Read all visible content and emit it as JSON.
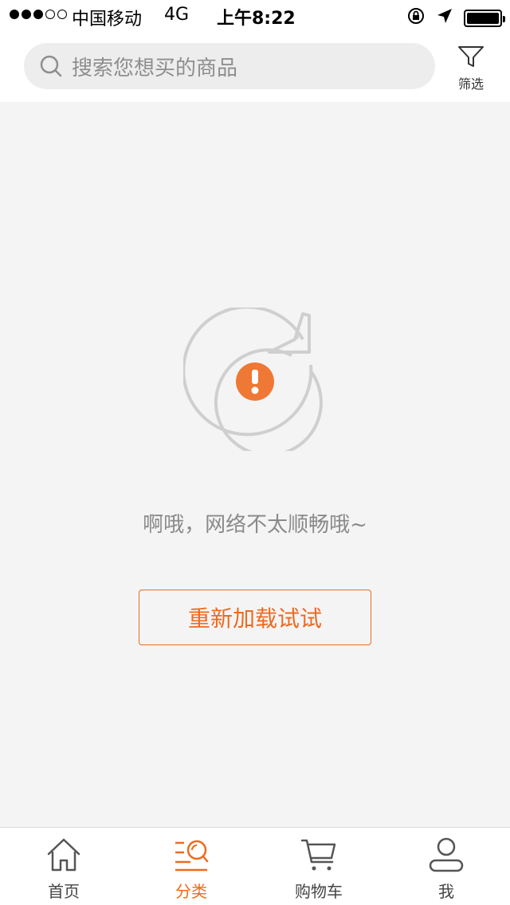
{
  "status_bar": {
    "carrier": "中国移动",
    "network": "4G",
    "time": "上午8:22"
  },
  "search": {
    "placeholder": "搜索您想买的商品",
    "icon": "search-icon"
  },
  "filter": {
    "label": "筛选",
    "icon": "filter-icon"
  },
  "error": {
    "message": "啊哦，网络不太顺畅哦~",
    "reload_label": "重新加载试试",
    "icon": "reload-warning-icon"
  },
  "tabs": [
    {
      "label": "首页",
      "icon": "home-icon",
      "active": false
    },
    {
      "label": "分类",
      "icon": "category-icon",
      "active": true
    },
    {
      "label": "购物车",
      "icon": "cart-icon",
      "active": false
    },
    {
      "label": "我",
      "icon": "user-icon",
      "active": false
    }
  ],
  "colors": {
    "accent": "#ee6a1f",
    "background": "#f4f4f4",
    "text_muted": "#8a8a8a"
  }
}
